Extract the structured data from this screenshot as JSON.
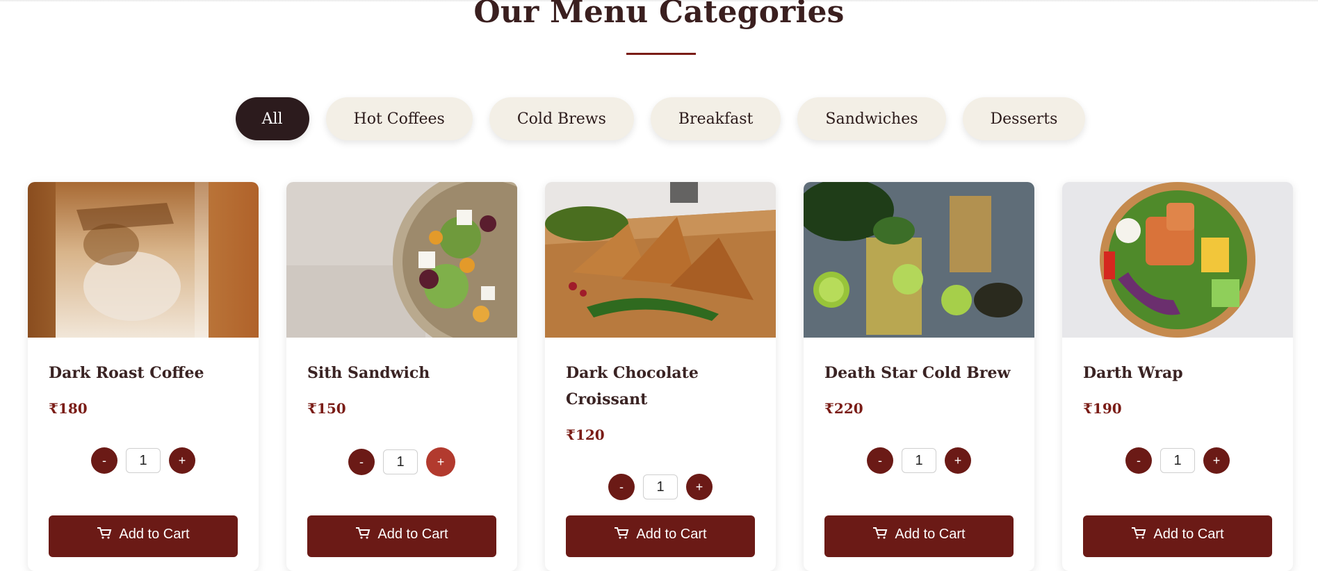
{
  "section": {
    "title": "Our Menu Categories"
  },
  "filters": [
    {
      "label": "All",
      "active": true
    },
    {
      "label": "Hot Coffees"
    },
    {
      "label": "Cold Brews"
    },
    {
      "label": "Breakfast"
    },
    {
      "label": "Sandwiches"
    },
    {
      "label": "Desserts"
    }
  ],
  "items": [
    {
      "name": "Dark Roast Coffee",
      "price": "₹180",
      "qty": "1",
      "add_label": "Add to Cart",
      "image": "iced-coffee-photo"
    },
    {
      "name": "Sith Sandwich",
      "price": "₹150",
      "qty": "1",
      "add_label": "Add to Cart",
      "image": "salad-plate-photo"
    },
    {
      "name": "Dark Chocolate Croissant",
      "price": "₹120",
      "qty": "1",
      "add_label": "Add to Cart",
      "image": "samosa-board-photo"
    },
    {
      "name": "Death Star Cold Brew",
      "price": "₹220",
      "qty": "1",
      "add_label": "Add to Cart",
      "image": "lime-drinks-photo"
    },
    {
      "name": "Darth Wrap",
      "price": "₹190",
      "qty": "1",
      "add_label": "Add to Cart",
      "image": "salmon-bowl-photo"
    }
  ],
  "qty_controls": {
    "minus": "-",
    "plus": "+"
  },
  "colors": {
    "primary": "#6b1a16",
    "dark": "#2c1b1d",
    "pill": "#f3efe6",
    "hover": "#b23a2e"
  }
}
